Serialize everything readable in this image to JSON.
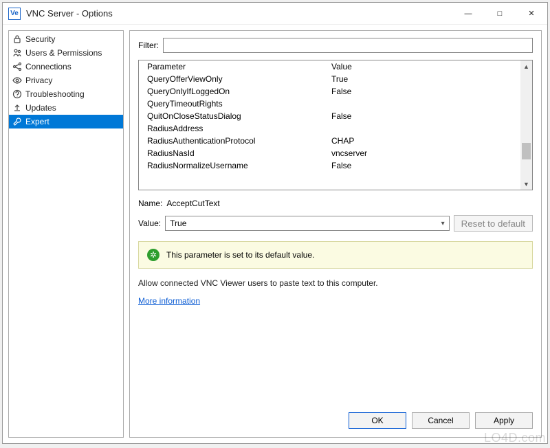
{
  "window": {
    "title": "VNC Server - Options",
    "icon_text": "Ve"
  },
  "sidebar": {
    "items": [
      {
        "label": "Security",
        "icon": "lock"
      },
      {
        "label": "Users & Permissions",
        "icon": "users"
      },
      {
        "label": "Connections",
        "icon": "connections"
      },
      {
        "label": "Privacy",
        "icon": "eye"
      },
      {
        "label": "Troubleshooting",
        "icon": "question"
      },
      {
        "label": "Updates",
        "icon": "upload"
      },
      {
        "label": "Expert",
        "icon": "wrench",
        "selected": true
      }
    ]
  },
  "filter": {
    "label": "Filter:",
    "value": ""
  },
  "param_table": {
    "headers": {
      "col1": "Parameter",
      "col2": "Value"
    },
    "rows": [
      {
        "param": "QueryOfferViewOnly",
        "value": "True"
      },
      {
        "param": "QueryOnlyIfLoggedOn",
        "value": "False"
      },
      {
        "param": "QueryTimeoutRights",
        "value": ""
      },
      {
        "param": "QuitOnCloseStatusDialog",
        "value": "False"
      },
      {
        "param": "RadiusAddress",
        "value": ""
      },
      {
        "param": "RadiusAuthenticationProtocol",
        "value": "CHAP"
      },
      {
        "param": "RadiusNasId",
        "value": "vncserver"
      },
      {
        "param": "RadiusNormalizeUsername",
        "value": "False"
      }
    ]
  },
  "detail": {
    "name_label": "Name:",
    "name_value": "AcceptCutText",
    "value_label": "Value:",
    "value_selected": "True",
    "reset_label": "Reset to default",
    "banner_text": "This parameter is set to its default value.",
    "description": "Allow connected VNC Viewer users to paste text to this computer.",
    "more_link": "More information"
  },
  "buttons": {
    "ok": "OK",
    "cancel": "Cancel",
    "apply": "Apply"
  },
  "watermark": "LO4D.com"
}
